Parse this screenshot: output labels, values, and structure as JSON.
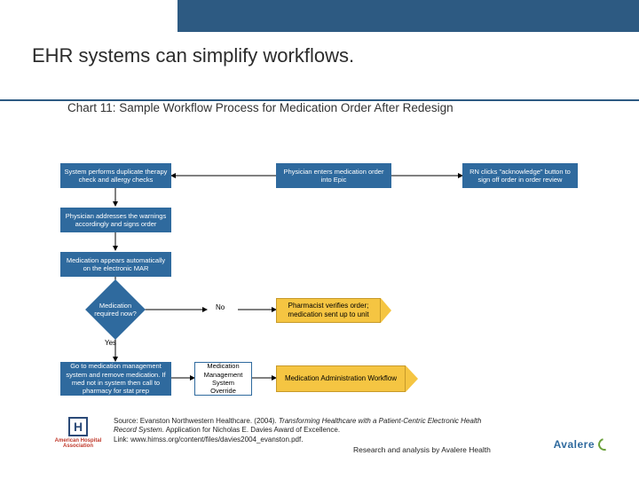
{
  "header": {
    "title": "EHR systems can simplify workflows.",
    "subtitle": "Chart 11: Sample Workflow Process for Medication Order After Redesign"
  },
  "nodes": {
    "physician_enters": "Physician enters medication order into Epic",
    "system_checks": "System performs duplicate therapy check and allergy checks",
    "rn_ack": "RN clicks \"acknowledge\" button to sign off order in order review",
    "physician_addresses": "Physician addresses the warnings accordingly and signs order",
    "med_appears": "Medication appears automatically on the electronic MAR",
    "decision": "Medication required now?",
    "decision_no": "No",
    "decision_yes": "Yes",
    "pharmacist_verifies": "Pharmacist verifies order; medication sent up to unit",
    "goto_mgmt": "Go to medication management system and remove medication. If med not in system then call to pharmacy for stat prep",
    "override": "Medication Management System Override",
    "admin_workflow": "Medication Administration Workflow"
  },
  "footer": {
    "source_prefix": "Source: Evanston Northwestern Healthcare. (2004). ",
    "source_italic": "Transforming Healthcare with a Patient-Centric Electronic Health Record System.",
    "source_suffix": " Application for Nicholas E. Davies Award of Excellence.",
    "link_label": "Link: www.himss.org/content/files/davies2004_evanston.pdf.",
    "attribution": "Research and analysis by Avalere Health",
    "logo_aha": "American Hospital Association",
    "logo_avalere": "Avalere"
  }
}
